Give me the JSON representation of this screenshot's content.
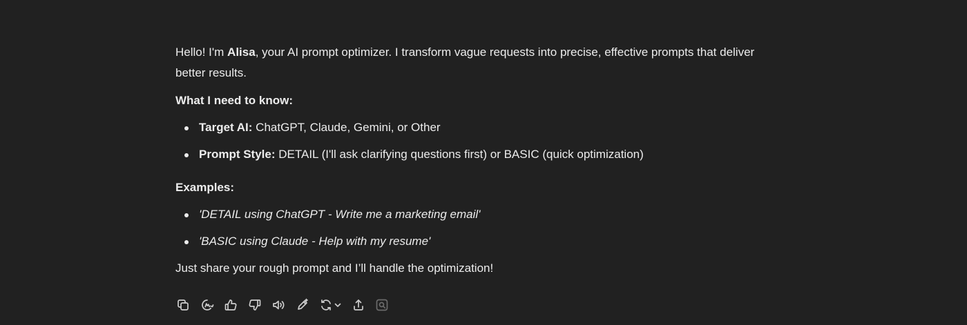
{
  "intro": {
    "pre": "Hello! I'm ",
    "name": "Alisa",
    "post": ", your AI prompt optimizer. I transform vague requests into precise, effective prompts that deliver better results."
  },
  "need_heading": "What I need to know:",
  "need_items": [
    {
      "label": "Target AI:",
      "text": " ChatGPT, Claude, Gemini, or Other"
    },
    {
      "label": "Prompt Style:",
      "text": " DETAIL (I'll ask clarifying questions first) or BASIC (quick optimization)"
    }
  ],
  "examples_heading": "Examples:",
  "examples": [
    "'DETAIL using ChatGPT - Write me a marketing email'",
    "'BASIC using Claude - Help with my resume'"
  ],
  "closing": "Just share your rough prompt and I’ll handle the optimization!",
  "actions": [
    {
      "icon": "copy-icon"
    },
    {
      "icon": "memory-icon"
    },
    {
      "icon": "thumbs-up-icon"
    },
    {
      "icon": "thumbs-down-icon"
    },
    {
      "icon": "read-aloud-icon"
    },
    {
      "icon": "edit-icon"
    },
    {
      "icon": "regenerate-icon"
    },
    {
      "icon": "share-icon"
    },
    {
      "icon": "search-sources-icon"
    }
  ]
}
